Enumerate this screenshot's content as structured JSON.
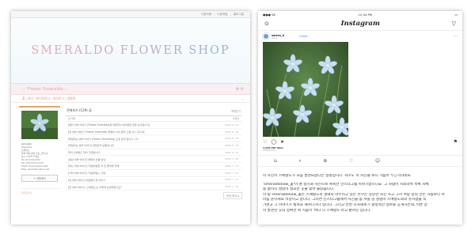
{
  "blog": {
    "topbar": [
      "다음카페",
      "다음메일",
      "블로그홈"
    ],
    "title": "SMERALDO FLOWER SHOP",
    "subname": ":: Flower Smeraldo ::",
    "subicons": "⚙ ⟳",
    "navbar_left": "홈 | 태그 | 미디어로그 | 위치로그 | 방명록",
    "navbar_right": "⌄",
    "profile": {
      "lines": [
        "smeraldo",
        "Smeraldo",
        "",
        "스메랄도",
        "꽃의 약속 문의 블로그입니다.",
        "잠시 기다려 주세요.",
        "",
        "Tel. 02-XXX-XXXX",
        "",
        "Tel. 070-XXXX-XXXX",
        "Email. flower@smeraldo",
        "Blog. smeraldo.daum.net"
      ],
      "button": "+ 이웃추가",
      "bottom": "카테고리 ▸"
    },
    "list": {
      "header": "전체보기 (129) 글",
      "header_right": "목록닫기",
      "col_title": "글 제목",
      "col_date": "작성일",
      "rows": [
        {
          "title": "[얼전 외부 이야기 (Flower Smeraldo)를 방문하신 여러분을 정말 감사합니다]",
          "date": "2018. 8. 15."
        },
        {
          "title": "[꽃 외부 이야기 (Flower Smeraldo) 꽃말의 의미 알려 드립니다. (2/14)]",
          "date": "2018. 8. 15."
        },
        {
          "title": "[하늘하는 외부 이야기 (Flower Smeraldo)] 도면 준비 합니다. (2)",
          "date": "2018. 8. 15."
        },
        {
          "title": "[하늘하는 외부 이야기] 대한민국 공원입니다.",
          "date": "2018. 8. 15."
        },
        {
          "title": "파티 스메랄도 파티 가입합니다",
          "date": "2018. 8. 10."
        },
        {
          "title": "[일반 외부 이야기] 변화의 흐름 만남",
          "date": "2018. 7. 26."
        },
        {
          "title": "[하는 외부 이야기] '하늘하늘한 하 한 플라워 카페'",
          "date": "2018. 7. 21."
        },
        {
          "title": "[기타 외부 이야기] '하늘하늘스 기독'",
          "date": "2018. 7. 21."
        },
        {
          "title": "[외 외부 이야기] 이원평의 꽃 이야기",
          "date": "2018. 7. 15."
        },
        {
          "title": "[한 외부 이야기] '스메랄도'는 어떻게 탄생하였나요?",
          "date": "2018. 7. 15."
        }
      ],
      "more": "이전 보기 ▸"
    }
  },
  "insta": {
    "status_left": "●●● SK",
    "status_time": "12:34 PM",
    "status_right": "▭",
    "logo": "Instagram",
    "nav_left_icon": "⊙",
    "nav_right_icon": "▽",
    "post_user": "smera_d",
    "post_sub": "Seoul",
    "follow": "Follow",
    "more_icon": "⋯",
    "likes": "1,033,307 likes",
    "date": "6 DAYS AGO",
    "tabs": [
      "⌂",
      "⌕",
      "⊕",
      "♡",
      "☺"
    ],
    "text": [
      "이 사진이 스메랄도가 처음 발견되었다는 정원입니다. 자꾸도 저 사진을 보니 가슴이 두근거리네요.",
      "",
      "'smeraldonow_꽃'이 명 정시와 사진으로 촉촉한 인스타그램 이야기였으니요. 그 사람이 지뢰라며 목록 자체",
      "를 없이지 않았이 필요한 곳을 찾아 올렸습니다.",
      "이 탑 smeraldonow_꽃는 스메랄도의 생애의 마무리고 있는 유무는 상당한 사진 하고 그저 서탕 중의 만는 하를보다 아",
      "마음 윤이세요 이정이고 합니다. 그러면 인스타그램에서 사진을 좀 서를 중 행행이 스메랄도와의 유사점을 적",
      "가졌고 그 이야기가 될까요 해커니거나 입니다. 그리고 한번 조사해보기 결정적인 정보를 공개하는데, 이론 글",
      "이 발견한 곳의 정확한 위 치좀이 '바다 다 스메랄도'라고 밝혀진 입니다."
    ]
  },
  "colors": {
    "accent_orange": "#e0a566",
    "pink_bar": "#f9eef1",
    "ig_blue": "#3897f0"
  }
}
